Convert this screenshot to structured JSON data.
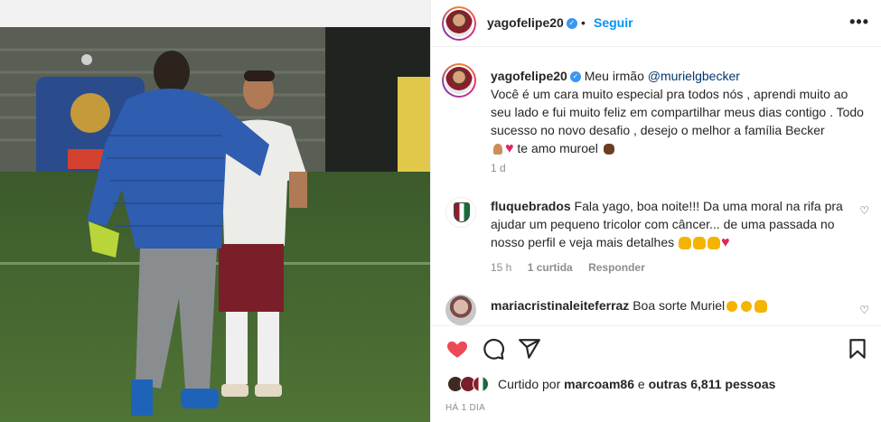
{
  "post": {
    "author": "yagofelipe20",
    "follow_label": "Seguir",
    "dot": "•",
    "more_label": "•••",
    "verified_mark": "✓"
  },
  "caption": {
    "author": "yagofelipe20",
    "intro": " Meu irmão ",
    "mention": "@murielgbecker",
    "body": "Você é um cara muito especial pra todos nós , aprendi muito ao seu lado e fui muito feliz em compartilhar meus dias contigo . Todo sucesso no novo desafio , desejo o melhor a família Becker",
    "end": " te amo muroel ",
    "time": "1 d"
  },
  "comments": [
    {
      "author": "fluquebrados",
      "text": " Fala yago, boa noite!!! Da uma moral na rifa pra ajudar um pequeno tricolor com câncer... de uma passada no nosso perfil e veja mais detalhes ",
      "time": "15 h",
      "likes": "1 curtida",
      "reply": "Responder"
    },
    {
      "author": "mariacristinaleiteferraz",
      "text": " Boa sorte Muriel"
    }
  ],
  "likes": {
    "prefix": "Curtido por ",
    "user": "marcoam86",
    "middle": " e ",
    "others": "outras 6,811 pessoas"
  },
  "posted_ago": "HÁ 1 DIA",
  "icons": {
    "heart": "heart-filled-icon",
    "comment": "comment-icon",
    "share": "share-icon",
    "save": "bookmark-icon"
  },
  "colors": {
    "accent": "#0095f6",
    "like_red": "#ed4956",
    "mention": "#00376b",
    "muted": "#8e8e8e"
  }
}
